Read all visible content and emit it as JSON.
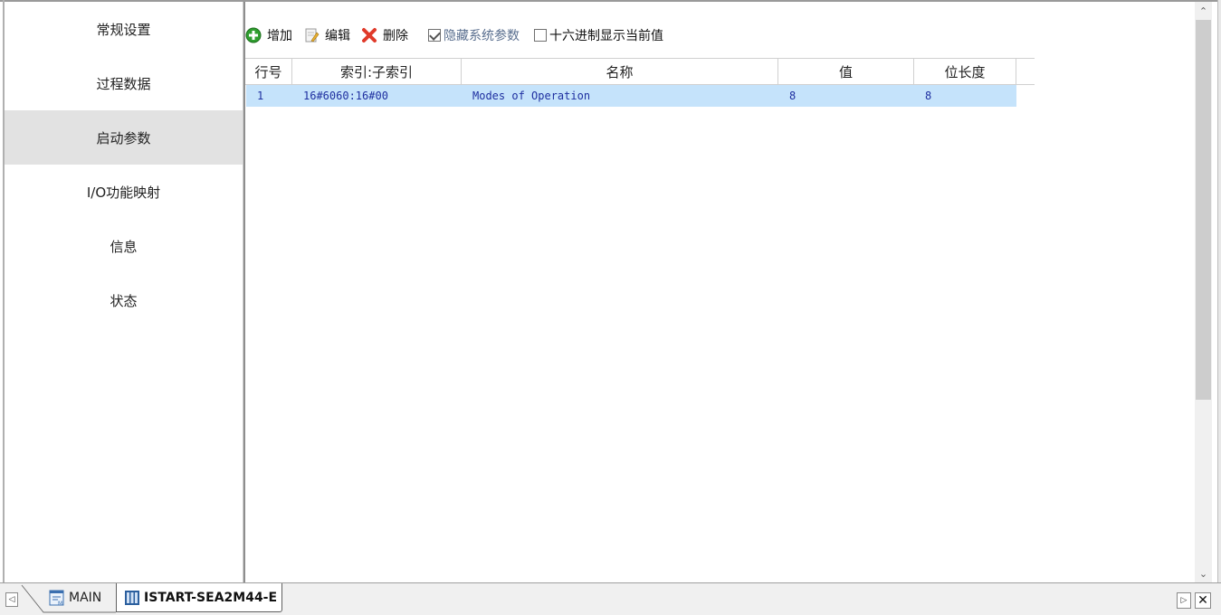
{
  "sidebar": {
    "items": [
      {
        "label": "常规设置"
      },
      {
        "label": "过程数据"
      },
      {
        "label": "启动参数"
      },
      {
        "label": "I/O功能映射"
      },
      {
        "label": "信息"
      },
      {
        "label": "状态"
      }
    ],
    "active_index": 2
  },
  "toolbar": {
    "add_label": "增加",
    "edit_label": "编辑",
    "delete_label": "删除",
    "hide_system_params_label": "隐藏系统参数",
    "hide_system_params_checked": true,
    "hex_display_label": "十六进制显示当前值",
    "hex_display_checked": false
  },
  "grid": {
    "columns": [
      "行号",
      "索引:子索引",
      "名称",
      "值",
      "位长度"
    ],
    "rows": [
      {
        "row": "1",
        "index": "16#6060:16#00",
        "name": "Modes of Operation",
        "value": "8",
        "bit_length": "8"
      }
    ]
  },
  "tabs": {
    "items": [
      {
        "label": "MAIN"
      },
      {
        "label": "ISTART-SEA2M44-E"
      }
    ],
    "active_index": 1
  },
  "colors": {
    "selected_row": "#c5e3fb",
    "row_text": "#1e2fa0",
    "active_sidebar": "#e2e2e2"
  },
  "icons": {
    "add": "plus-circle-green-icon",
    "edit": "edit-document-icon",
    "delete": "red-x-icon",
    "main_tab": "program-icon",
    "device_tab": "device-icon"
  }
}
